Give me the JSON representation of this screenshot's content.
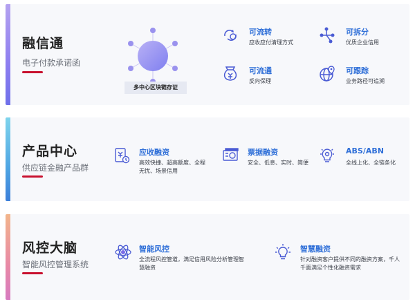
{
  "sections": [
    {
      "title": "融信通",
      "subtitle": "电子付款承诺函",
      "center_label": "多中心区块链存证",
      "features": [
        {
          "name": "可流转",
          "desc": "应收应付清理方式",
          "icon": "cycle-arrows-icon"
        },
        {
          "name": "可拆分",
          "desc": "优质企业信用",
          "icon": "split-nodes-icon"
        },
        {
          "name": "可流通",
          "desc": "反向保理",
          "icon": "money-bag-icon"
        },
        {
          "name": "可跟踪",
          "desc": "业务路径可追溯",
          "icon": "globe-pin-icon"
        }
      ]
    },
    {
      "title": "产品中心",
      "subtitle": "供应链金融产品群",
      "features": [
        {
          "name": "应收融资",
          "desc": "高效快捷、超高额度、全程无忧、场景信用",
          "icon": "document-yen-icon"
        },
        {
          "name": "票据融资",
          "desc": "安全、低息、实时、简便",
          "icon": "bill-icon"
        },
        {
          "name": "ABS/ABN",
          "desc": "全线上化、全链条化",
          "icon": "lightbulb-gear-icon"
        }
      ]
    },
    {
      "title": "风控大脑",
      "subtitle": "智能风控管理系统",
      "features": [
        {
          "name": "智能风控",
          "desc": "全流程风控管道，满足信用风险分析管理智慧融资",
          "icon": "atom-icon"
        },
        {
          "name": "智慧融资",
          "desc": "针对融资客户提供不同的融资方案，千人千面满足个性化融资需求",
          "icon": "bulb-icon"
        }
      ]
    }
  ],
  "colors": {
    "accent": "#2f6fd8",
    "red": "#c8102e",
    "purple": "#8d7ef0"
  }
}
